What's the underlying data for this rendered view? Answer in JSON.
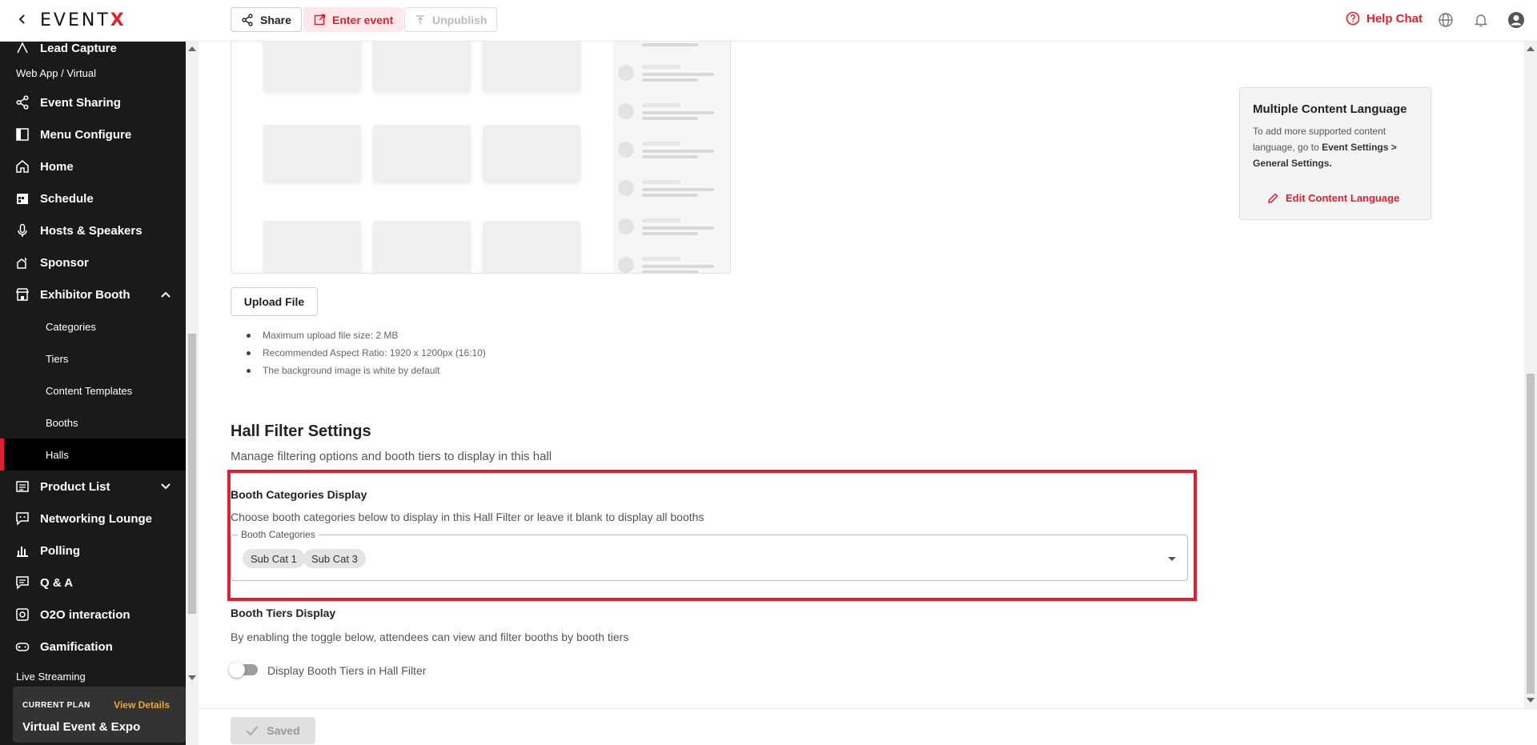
{
  "topbar": {
    "logo": {
      "main": "EVENT",
      "accent": "X"
    },
    "share_label": "Share",
    "enter_label": "Enter event",
    "unpublish_label": "Unpublish",
    "help_label": "Help Chat"
  },
  "sidebar": {
    "partial_top_item": "Lead Capture",
    "section_web": "Web App / Virtual",
    "items": [
      {
        "label": "Event Sharing",
        "icon": "share-icon"
      },
      {
        "label": "Menu Configure",
        "icon": "layout-icon"
      },
      {
        "label": "Home",
        "icon": "home-icon"
      },
      {
        "label": "Schedule",
        "icon": "calendar-icon"
      },
      {
        "label": "Hosts & Speakers",
        "icon": "microphone-icon"
      },
      {
        "label": "Sponsor",
        "icon": "sponsor-icon"
      },
      {
        "label": "Exhibitor Booth",
        "icon": "store-icon"
      }
    ],
    "sub_items": [
      "Categories",
      "Tiers",
      "Content Templates",
      "Booths",
      "Halls"
    ],
    "items_after": [
      {
        "label": "Product List",
        "icon": "list-icon"
      },
      {
        "label": "Networking Lounge",
        "icon": "chat-icon"
      },
      {
        "label": "Polling",
        "icon": "bar-chart-icon"
      },
      {
        "label": "Q & A",
        "icon": "qa-icon"
      },
      {
        "label": "O2O interaction",
        "icon": "o2o-icon"
      },
      {
        "label": "Gamification",
        "icon": "gamepad-icon"
      }
    ],
    "section_live": "Live Streaming",
    "plan": {
      "label": "CURRENT PLAN",
      "link": "View Details",
      "name": "Virtual Event & Expo"
    }
  },
  "main": {
    "upload_label": "Upload File",
    "notes": [
      "Maximum upload file size: 2 MB",
      "Recommended Aspect Ratio: 1920 x 1200px (16:10)",
      "The background image is white by default"
    ],
    "language_card": {
      "title": "Multiple Content Language",
      "text_before": "To add more supported content language, go to ",
      "text_bold": "Event Settings > General Settings.",
      "link": "Edit Content Language"
    },
    "hall_filter": {
      "title": "Hall Filter Settings",
      "subtitle": "Manage filtering options and booth tiers to display in this hall",
      "categories": {
        "title": "Booth Categories Display",
        "description": "Choose booth categories below to display in this Hall Filter or leave it blank to display all booths",
        "field_label": "Booth Categories",
        "selected": [
          "Sub Cat 1",
          "Sub Cat 3"
        ]
      },
      "tiers": {
        "title": "Booth Tiers Display",
        "description": "By enabling the toggle below, attendees can view and filter booths by booth tiers",
        "toggle_label": "Display Booth Tiers in Hall Filter",
        "toggle_on": false
      }
    },
    "saved_label": "Saved"
  },
  "colors": {
    "accent": "#e0202f",
    "sidebar_bg": "#1a1a1a",
    "plan_link": "#f5a623"
  }
}
